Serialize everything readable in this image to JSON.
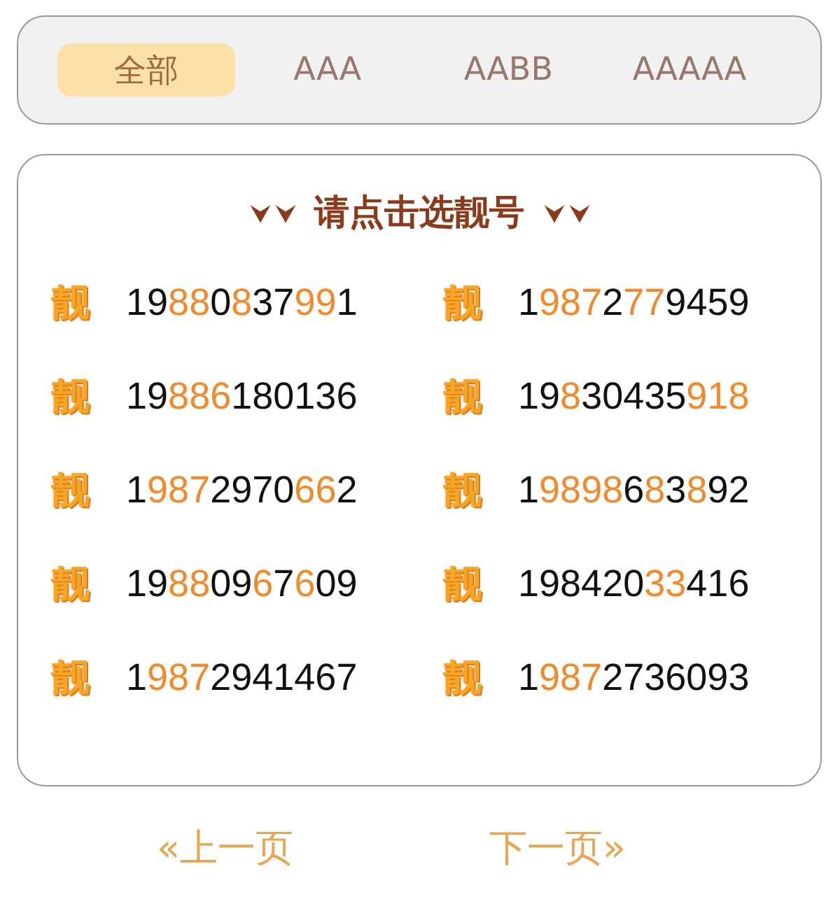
{
  "tabs": [
    {
      "label": "全部",
      "selected": true
    },
    {
      "label": "AAA",
      "selected": false
    },
    {
      "label": "AABB",
      "selected": false
    },
    {
      "label": "AAAAA",
      "selected": false
    }
  ],
  "card": {
    "title": "请点击选靓号",
    "numbers": [
      {
        "badge": "靓",
        "segments": [
          {
            "text": "19",
            "highlight": false
          },
          {
            "text": "88",
            "highlight": true
          },
          {
            "text": "0",
            "highlight": false
          },
          {
            "text": "8",
            "highlight": true
          },
          {
            "text": "37",
            "highlight": false
          },
          {
            "text": "99",
            "highlight": true
          },
          {
            "text": "1",
            "highlight": false
          }
        ]
      },
      {
        "badge": "靓",
        "segments": [
          {
            "text": "1",
            "highlight": false
          },
          {
            "text": "987",
            "highlight": true
          },
          {
            "text": "2",
            "highlight": false
          },
          {
            "text": "77",
            "highlight": true
          },
          {
            "text": "9459",
            "highlight": false
          }
        ]
      },
      {
        "badge": "靓",
        "segments": [
          {
            "text": "19",
            "highlight": false
          },
          {
            "text": "886",
            "highlight": true
          },
          {
            "text": "180136",
            "highlight": false
          }
        ]
      },
      {
        "badge": "靓",
        "segments": [
          {
            "text": "19",
            "highlight": false
          },
          {
            "text": "8",
            "highlight": true
          },
          {
            "text": "30435",
            "highlight": false
          },
          {
            "text": "918",
            "highlight": true
          }
        ]
      },
      {
        "badge": "靓",
        "segments": [
          {
            "text": "1",
            "highlight": false
          },
          {
            "text": "987",
            "highlight": true
          },
          {
            "text": "2970",
            "highlight": false
          },
          {
            "text": "66",
            "highlight": true
          },
          {
            "text": "2",
            "highlight": false
          }
        ]
      },
      {
        "badge": "靓",
        "segments": [
          {
            "text": "1",
            "highlight": false
          },
          {
            "text": "9898",
            "highlight": true
          },
          {
            "text": "6",
            "highlight": false
          },
          {
            "text": "8",
            "highlight": true
          },
          {
            "text": "3",
            "highlight": false
          },
          {
            "text": "8",
            "highlight": true
          },
          {
            "text": "92",
            "highlight": false
          }
        ]
      },
      {
        "badge": "靓",
        "segments": [
          {
            "text": "19",
            "highlight": false
          },
          {
            "text": "88",
            "highlight": true
          },
          {
            "text": "09",
            "highlight": false
          },
          {
            "text": "6",
            "highlight": true
          },
          {
            "text": "7",
            "highlight": false
          },
          {
            "text": "6",
            "highlight": true
          },
          {
            "text": "09",
            "highlight": false
          }
        ]
      },
      {
        "badge": "靓",
        "segments": [
          {
            "text": "198420",
            "highlight": false
          },
          {
            "text": "33",
            "highlight": true
          },
          {
            "text": "416",
            "highlight": false
          }
        ]
      },
      {
        "badge": "靓",
        "segments": [
          {
            "text": "1",
            "highlight": false
          },
          {
            "text": "987",
            "highlight": true
          },
          {
            "text": "2941467",
            "highlight": false
          }
        ]
      },
      {
        "badge": "靓",
        "segments": [
          {
            "text": "1",
            "highlight": false
          },
          {
            "text": "987",
            "highlight": true
          },
          {
            "text": "2736093",
            "highlight": false
          }
        ]
      }
    ]
  },
  "pagination": {
    "previous": "«上一页",
    "next": "下一页»"
  }
}
